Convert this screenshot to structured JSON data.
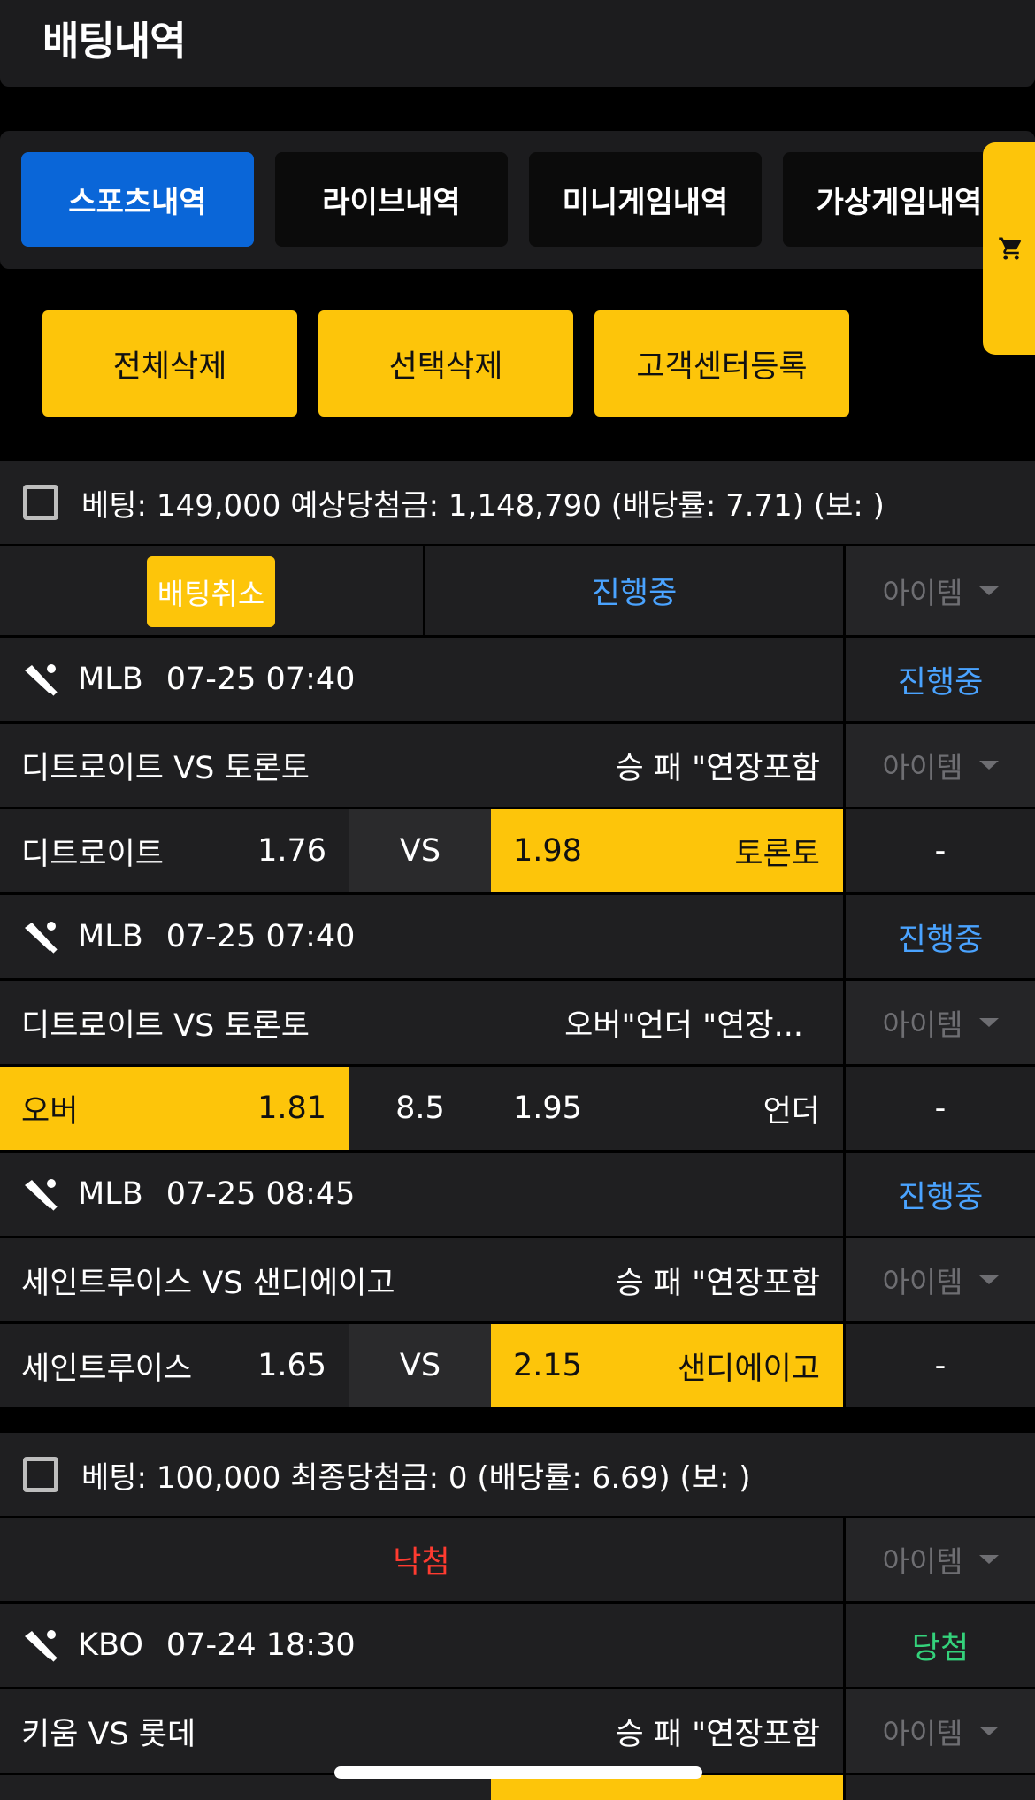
{
  "header": {
    "title": "배팅내역"
  },
  "tabs": [
    {
      "label": "스포츠내역",
      "active": true
    },
    {
      "label": "라이브내역",
      "active": false
    },
    {
      "label": "미니게임내역",
      "active": false
    },
    {
      "label": "가상게임내역",
      "active": false
    }
  ],
  "cart": {
    "icon": "cart-icon"
  },
  "actions": {
    "delete_all": "전체삭제",
    "delete_selected": "선택삭제",
    "support_register": "고객센터등록"
  },
  "bets": [
    {
      "summary": "베팅: 149,000 예상당첨금: 1,148,790 (배당률: 7.71) (보: )",
      "cancel_label": "배팅취소",
      "status": "진행중",
      "item_label": "아이템",
      "games": [
        {
          "league": "MLB",
          "datetime": "07-25 07:40",
          "status": "진행중",
          "matchup": "디트로이트 VS 토론토",
          "market": "승 패 \"연장포함",
          "item_label": "아이템",
          "home": "디트로이트",
          "home_odds": "1.76",
          "middle": "VS",
          "away_odds": "1.98",
          "away": "토론토",
          "selected": "away",
          "item_value": "-"
        },
        {
          "league": "MLB",
          "datetime": "07-25 07:40",
          "status": "진행중",
          "matchup": "디트로이트 VS 토론토",
          "market": "오버\"언더 \"연장...",
          "item_label": "아이템",
          "home": "오버",
          "home_odds": "1.81",
          "middle": "8.5",
          "away_odds": "1.95",
          "away": "언더",
          "selected": "home",
          "item_value": "-"
        },
        {
          "league": "MLB",
          "datetime": "07-25 08:45",
          "status": "진행중",
          "matchup": "세인트루이스 VS 샌디에이고",
          "market": "승 패 \"연장포함",
          "item_label": "아이템",
          "home": "세인트루이스",
          "home_odds": "1.65",
          "middle": "VS",
          "away_odds": "2.15",
          "away": "샌디에이고",
          "selected": "away",
          "item_value": "-"
        }
      ]
    },
    {
      "summary": "베팅: 100,000 최종당첨금: 0 (배당률: 6.69) (보: )",
      "status": "낙첨",
      "item_label": "아이템",
      "games": [
        {
          "league": "KBO",
          "datetime": "07-24 18:30",
          "status": "당첨",
          "matchup": "키움 VS 롯데",
          "market": "승 패 \"연장포함",
          "item_label": "아이템"
        }
      ]
    }
  ],
  "colors": {
    "accent_yellow": "#fdc50a",
    "active_blue": "#0a66d8",
    "status_blue": "#4aa3ff",
    "lose_red": "#ff3b30",
    "win_green": "#34d27b"
  }
}
